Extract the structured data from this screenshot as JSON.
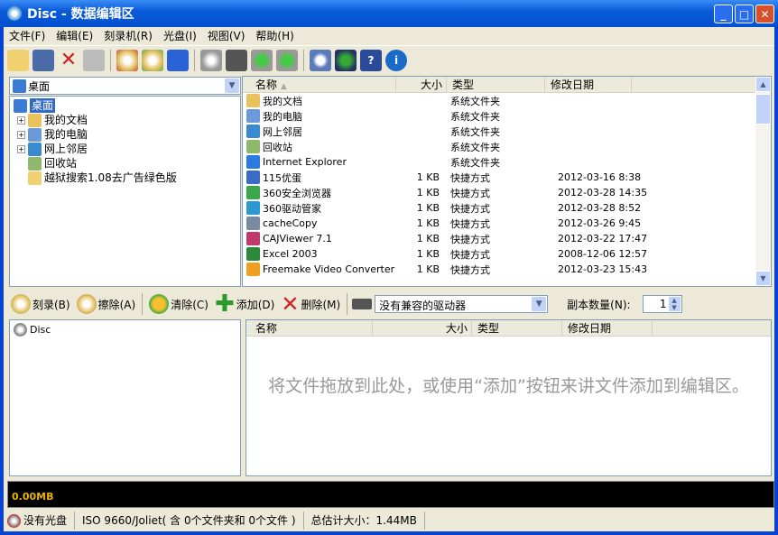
{
  "window": {
    "title": "Disc - 数据编辑区",
    "min": "_",
    "max": "□",
    "close": "✕"
  },
  "menu": [
    "文件(F)",
    "编辑(E)",
    "刻录机(R)",
    "光盘(I)",
    "视图(V)",
    "帮助(H)"
  ],
  "location": {
    "value": "桌面"
  },
  "tree": [
    {
      "label": "桌面",
      "expand": "",
      "color": "#3a7bd5"
    },
    {
      "label": "我的文档",
      "expand": "+",
      "color": "#e8c25a"
    },
    {
      "label": "我的电脑",
      "expand": "+",
      "color": "#6a9ad8"
    },
    {
      "label": "网上邻居",
      "expand": "+",
      "color": "#3a8ad0"
    },
    {
      "label": "回收站",
      "expand": "",
      "color": "#8fb86b"
    },
    {
      "label": "越狱搜索1.08去广告绿色版",
      "expand": "",
      "color": "#f0d070"
    }
  ],
  "file_list": {
    "columns": [
      "名称",
      "大小",
      "类型",
      "修改日期"
    ],
    "sort_icon": "▲",
    "rows": [
      {
        "name": "我的文档",
        "size": "",
        "type": "系统文件夹",
        "date": "",
        "color": "#e8c25a"
      },
      {
        "name": "我的电脑",
        "size": "",
        "type": "系统文件夹",
        "date": "",
        "color": "#6a9ad8"
      },
      {
        "name": "网上邻居",
        "size": "",
        "type": "系统文件夹",
        "date": "",
        "color": "#3a8ad0"
      },
      {
        "name": "回收站",
        "size": "",
        "type": "系统文件夹",
        "date": "",
        "color": "#8fb86b"
      },
      {
        "name": "Internet Explorer",
        "size": "",
        "type": "系统文件夹",
        "date": "",
        "color": "#2a7be0"
      },
      {
        "name": "115优蛋",
        "size": "1 KB",
        "type": "快捷方式",
        "date": "2012-03-16 8:38",
        "color": "#3a6bc5"
      },
      {
        "name": "360安全浏览器",
        "size": "1 KB",
        "type": "快捷方式",
        "date": "2012-03-28 14:35",
        "color": "#3aa84a"
      },
      {
        "name": "360驱动管家",
        "size": "1 KB",
        "type": "快捷方式",
        "date": "2012-03-28 8:52",
        "color": "#2a9ad0"
      },
      {
        "name": "cacheCopy",
        "size": "1 KB",
        "type": "快捷方式",
        "date": "2012-03-26 9:45",
        "color": "#7a8aa0"
      },
      {
        "name": "CAJViewer 7.1",
        "size": "1 KB",
        "type": "快捷方式",
        "date": "2012-03-22 17:47",
        "color": "#c03a6a"
      },
      {
        "name": "Excel 2003",
        "size": "1 KB",
        "type": "快捷方式",
        "date": "2008-12-06 12:57",
        "color": "#2a8a3a"
      },
      {
        "name": "Freemake Video Converter",
        "size": "1 KB",
        "type": "快捷方式",
        "date": "2012-03-23 15:43",
        "color": "#f0a020"
      }
    ]
  },
  "toolbar2": {
    "burn": "刻录(B)",
    "erase": "擦除(A)",
    "clear": "清除(C)",
    "add": "添加(D)",
    "delete": "删除(M)",
    "drive": "没有兼容的驱动器",
    "copies_label": "副本数量(N):",
    "copies": "1"
  },
  "disc_tree": {
    "root": "Disc"
  },
  "disc_list": {
    "columns": [
      "名称",
      "大小",
      "类型",
      "修改日期"
    ],
    "empty_hint": "将文件拖放到此处，或使用“添加”按钮来讲文件添加到编辑区。"
  },
  "capacity": {
    "used": "0.00MB"
  },
  "status": {
    "disc": "没有光盘",
    "fs": "ISO 9660/Joliet( 含 0个文件夹和 0个文件 )",
    "size": "总估计大小：1.44MB"
  }
}
